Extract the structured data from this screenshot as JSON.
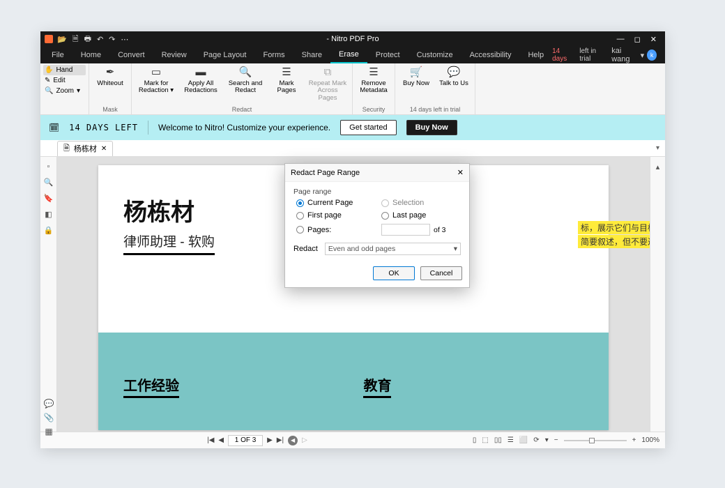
{
  "title": "- Nitro PDF Pro",
  "trial": {
    "days": "14 days",
    "remain": "left in trial"
  },
  "user": {
    "name": "kai wang",
    "initial": "k"
  },
  "menu": {
    "file": "File",
    "home": "Home",
    "convert": "Convert",
    "review": "Review",
    "pagelayout": "Page Layout",
    "forms": "Forms",
    "share": "Share",
    "erase": "Erase",
    "protect": "Protect",
    "customize": "Customize",
    "accessibility": "Accessibility",
    "help": "Help"
  },
  "tools": {
    "hand": "Hand",
    "edit": "Edit",
    "zoom": "Zoom"
  },
  "ribbon": {
    "whiteout": "Whiteout",
    "markred": "Mark for Redaction",
    "applyall": "Apply All Redactions",
    "searchredact": "Search and Redact",
    "markpages": "Mark Pages",
    "repeatmark": "Repeat Mark Across Pages",
    "removemeta": "Remove Metadata",
    "buynow": "Buy Now",
    "talk": "Talk to Us",
    "g_mask": "Mask",
    "g_redact": "Redact",
    "g_security": "Security",
    "g_trial": "14 days left in trial"
  },
  "banner": {
    "days": "14 DAYS LEFT",
    "welcome": "Welcome to Nitro! Customize your experience.",
    "getstarted": "Get started",
    "buy": "Buy Now"
  },
  "doctab": {
    "name": "杨栋材"
  },
  "page": {
    "name": "杨栋材",
    "sub": "律师助理 - 软购",
    "hl1": "标，展示它们与目标工作描述",
    "hl2": "简要叙述，但不要过于笼统。",
    "work": "工作经验",
    "edu": "教育"
  },
  "dialog": {
    "title": "Redact Page Range",
    "pagerange": "Page range",
    "current": "Current Page",
    "selection": "Selection",
    "first": "First page",
    "last": "Last page",
    "pages": "Pages:",
    "of": "of 3",
    "redact": "Redact",
    "select": "Even and odd pages",
    "ok": "OK",
    "cancel": "Cancel"
  },
  "status": {
    "page": "1 OF 3",
    "zoom": "100%"
  }
}
